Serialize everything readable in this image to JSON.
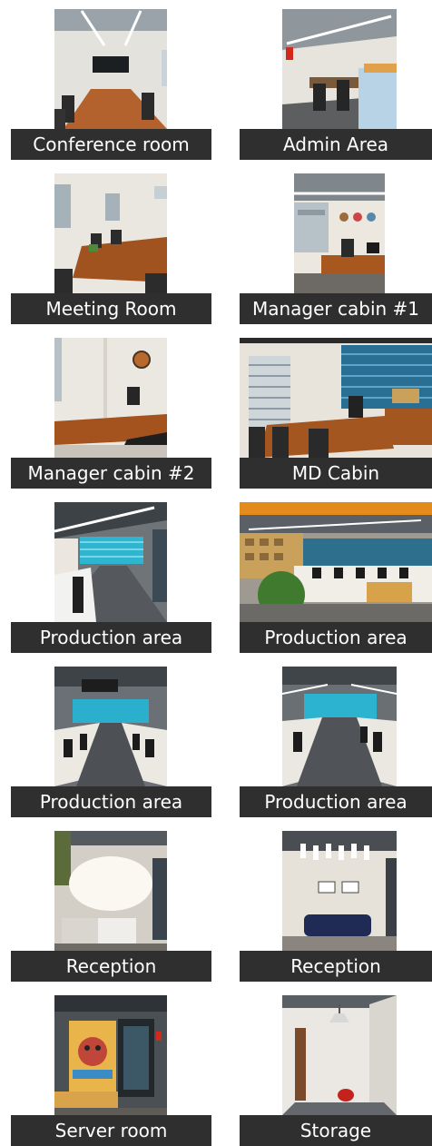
{
  "gallery": {
    "items": [
      {
        "label": "Conference room",
        "scene": "conference"
      },
      {
        "label": "Admin Area",
        "scene": "admin"
      },
      {
        "label": "Meeting Room",
        "scene": "meeting"
      },
      {
        "label": "Manager cabin #1",
        "scene": "cabin1"
      },
      {
        "label": "Manager cabin #2",
        "scene": "cabin2"
      },
      {
        "label": "MD Cabin",
        "scene": "md"
      },
      {
        "label": "Production area",
        "scene": "production1"
      },
      {
        "label": "Production area",
        "scene": "production2"
      },
      {
        "label": "Production area",
        "scene": "production3"
      },
      {
        "label": "Production area",
        "scene": "production4"
      },
      {
        "label": "Reception",
        "scene": "reception1"
      },
      {
        "label": "Reception",
        "scene": "reception2"
      },
      {
        "label": "Server room",
        "scene": "server"
      },
      {
        "label": "Storage",
        "scene": "storage"
      }
    ]
  },
  "colors": {
    "caption_bg": "#2f2f2f",
    "caption_text": "#ffffff",
    "page_bg": "#ffffff"
  }
}
